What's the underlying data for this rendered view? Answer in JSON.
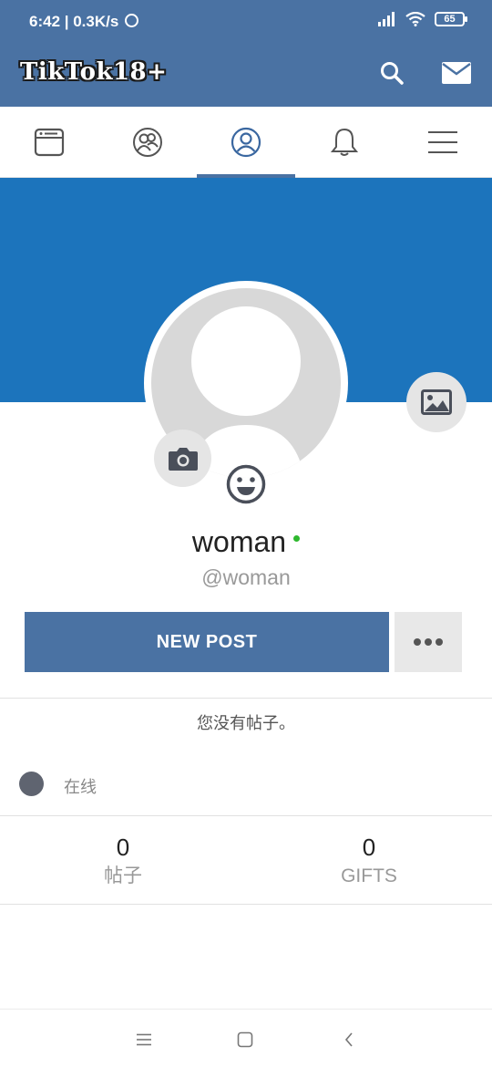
{
  "status_bar": {
    "time_speed": "6:42 | 0.3K/s",
    "battery": "65"
  },
  "header": {
    "logo": "TikTok18+",
    "icons": [
      "search-icon",
      "mail-icon"
    ]
  },
  "tabs": [
    {
      "name": "news-feed",
      "icon": "newspaper-icon",
      "active": false
    },
    {
      "name": "friends",
      "icon": "friends-icon",
      "active": false
    },
    {
      "name": "profile",
      "icon": "user-icon",
      "active": true
    },
    {
      "name": "notifications",
      "icon": "bell-icon",
      "active": false
    },
    {
      "name": "menu",
      "icon": "hamburger-icon",
      "active": false
    }
  ],
  "profile": {
    "name": "woman",
    "handle": "@woman",
    "online": true
  },
  "actions": {
    "new_post": "NEW POST"
  },
  "posts": {
    "empty_message": "您没有帖子。"
  },
  "presence": {
    "label": "在线"
  },
  "stats": {
    "posts": {
      "value": "0",
      "label": "帖子"
    },
    "gifts": {
      "value": "0",
      "label": "GIFTS"
    }
  },
  "colors": {
    "header": "#4a72a3",
    "cover": "#1c74bc",
    "online": "#2eb82e"
  }
}
